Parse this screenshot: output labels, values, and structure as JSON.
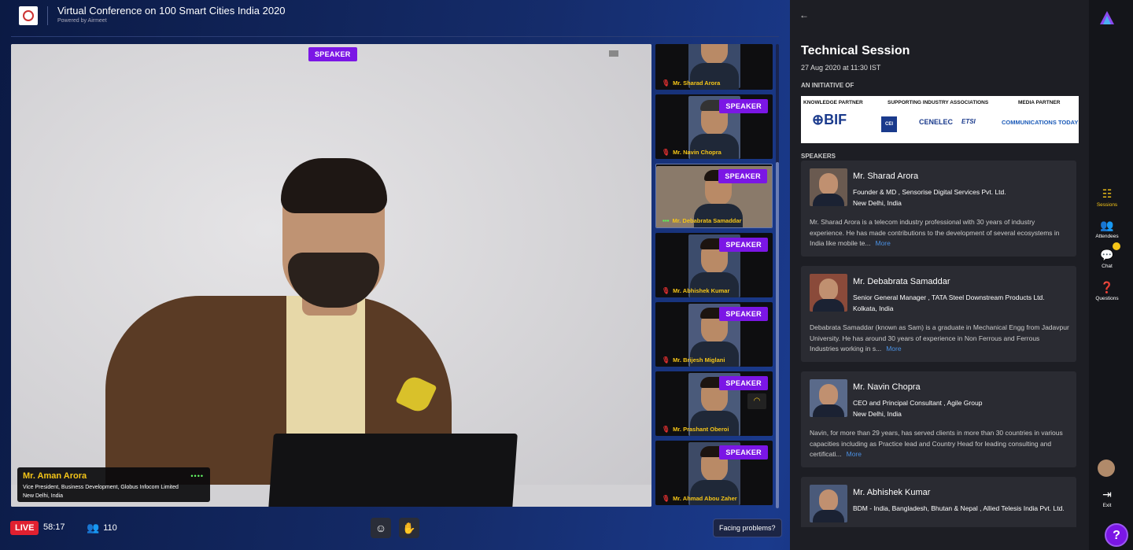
{
  "header": {
    "title": "Virtual Conference on 100 Smart Cities India 2020",
    "powered_by": "Powered by Airmeet"
  },
  "main_video": {
    "badge": "SPEAKER",
    "name": "Mr. Aman Arora",
    "role": "Vice President, Business Development, Globus Infocom Limited",
    "location": "New Delhi, India",
    "signal": "••••"
  },
  "tiles": [
    {
      "name": "Mr. Sharad Arora",
      "badge": ""
    },
    {
      "name": "Mr. Navin Chopra",
      "badge": "SPEAKER"
    },
    {
      "name": "Mr. Debabrata Samaddar",
      "badge": "SPEAKER"
    },
    {
      "name": "Mr. Abhishek Kumar",
      "badge": "SPEAKER"
    },
    {
      "name": "Mr. Brijesh Miglani",
      "badge": "SPEAKER"
    },
    {
      "name": "Mr. Prashant Oberoi",
      "badge": "SPEAKER"
    },
    {
      "name": "Mr. Ahmad Abou Zaher",
      "badge": "SPEAKER"
    }
  ],
  "bottom_bar": {
    "live": "LIVE",
    "timer": "58:17",
    "attendees": "110",
    "facing_problems": "Facing problems?"
  },
  "panel": {
    "title": "Technical Session",
    "date": "27 Aug 2020 at 11:30 IST",
    "initiative": "AN INITIATIVE OF",
    "partner_headers": {
      "knowledge": "KNOWLEDGE PARTNER",
      "supporting": "SUPPORTING INDUSTRY ASSOCIATIONS",
      "media": "MEDIA PARTNER"
    },
    "partner_logos": {
      "bif": "BIF",
      "cenelec": "CENELEC",
      "etsi": "ETSI",
      "media": "COMMUNICATIONS TODAY"
    },
    "speakers_heading": "SPEAKERS",
    "more_label": "More",
    "speakers": [
      {
        "name": "Mr. Sharad Arora",
        "role": "Founder & MD , Sensorise Digital Services Pvt. Ltd.",
        "location": "New Delhi, India",
        "bio": "Mr. Sharad Arora is a telecom industry professional with 30 years of industry experience. He has made contributions to the development of several ecosystems in India like mobile te..."
      },
      {
        "name": "Mr. Debabrata Samaddar",
        "role": "Senior General Manager , TATA Steel Downstream Products Ltd.",
        "location": "Kolkata, India",
        "bio": "Debabrata Samaddar (known as Sam) is a graduate in Mechanical Engg from Jadavpur University. He has around 30 years of experience in Non Ferrous and Ferrous Industries working in s..."
      },
      {
        "name": "Mr. Navin Chopra",
        "role": "CEO and Principal Consultant , Agile Group",
        "location": "New Delhi, India",
        "bio": "Navin, for more than 29 years, has served clients in more than 30 countries in various capacities including as Practice lead and Country Head for leading consulting and certificati..."
      },
      {
        "name": "Mr. Abhishek Kumar",
        "role": "BDM - India, Bangladesh, Bhutan & Nepal , Allied Telesis India Pvt. Ltd.",
        "location": "",
        "bio": ""
      }
    ]
  },
  "nav": {
    "sessions": "Sessions",
    "attendees": "Attendees",
    "chat": "Chat",
    "questions": "Questions",
    "exit": "Exit",
    "help": "?"
  },
  "colors": {
    "accent": "#7b16e5",
    "name_yellow": "#f5c518",
    "live_red": "#e02030"
  }
}
